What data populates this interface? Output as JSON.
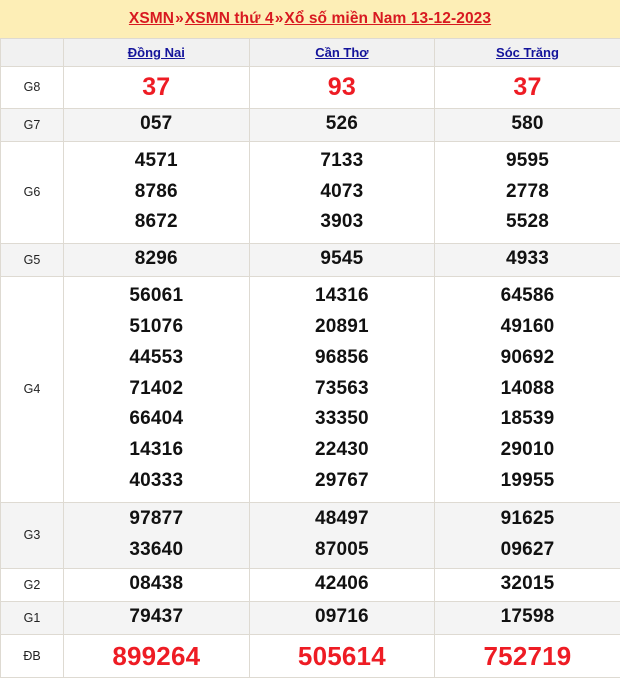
{
  "header": {
    "breadcrumb": [
      {
        "label": "XSMN",
        "type": "link"
      },
      {
        "label": "»",
        "type": "separator"
      },
      {
        "label": "XSMN thứ 4",
        "type": "link"
      },
      {
        "label": "»",
        "type": "separator"
      },
      {
        "label": "Xổ số miền Nam 13-12-2023",
        "type": "link"
      }
    ],
    "full_title": "XSMN » XSMN thứ 4 » Xổ số miền Nam 13-12-2023",
    "title_color": "#d81920",
    "band_color": "#fdeeb6"
  },
  "table": {
    "corner_label": "",
    "columns": [
      {
        "label": "Đồng Nai"
      },
      {
        "label": "Cần Thơ"
      },
      {
        "label": "Sóc Trăng"
      }
    ],
    "column_color": "#14149b",
    "highlight_color": "#ee1c24",
    "rows": [
      {
        "prize": "G8",
        "style": "highlight",
        "shaded": false,
        "values": [
          [
            "37"
          ],
          [
            "93"
          ],
          [
            "37"
          ]
        ]
      },
      {
        "prize": "G7",
        "style": "normal",
        "shaded": true,
        "values": [
          [
            "057"
          ],
          [
            "526"
          ],
          [
            "580"
          ]
        ]
      },
      {
        "prize": "G6",
        "style": "normal",
        "shaded": false,
        "values": [
          [
            "4571",
            "8786",
            "8672"
          ],
          [
            "7133",
            "4073",
            "3903"
          ],
          [
            "9595",
            "2778",
            "5528"
          ]
        ]
      },
      {
        "prize": "G5",
        "style": "normal",
        "shaded": true,
        "values": [
          [
            "8296"
          ],
          [
            "9545"
          ],
          [
            "4933"
          ]
        ]
      },
      {
        "prize": "G4",
        "style": "normal",
        "shaded": false,
        "values": [
          [
            "56061",
            "51076",
            "44553",
            "71402",
            "66404",
            "14316",
            "40333"
          ],
          [
            "14316",
            "20891",
            "96856",
            "73563",
            "33350",
            "22430",
            "29767"
          ],
          [
            "64586",
            "49160",
            "90692",
            "14088",
            "18539",
            "29010",
            "19955"
          ]
        ]
      },
      {
        "prize": "G3",
        "style": "normal",
        "shaded": true,
        "values": [
          [
            "97877",
            "33640"
          ],
          [
            "48497",
            "87005"
          ],
          [
            "91625",
            "09627"
          ]
        ]
      },
      {
        "prize": "G2",
        "style": "normal",
        "shaded": false,
        "values": [
          [
            "08438"
          ],
          [
            "42406"
          ],
          [
            "32015"
          ]
        ]
      },
      {
        "prize": "G1",
        "style": "normal",
        "shaded": true,
        "values": [
          [
            "79437"
          ],
          [
            "09716"
          ],
          [
            "17598"
          ]
        ]
      },
      {
        "prize": "ĐB",
        "style": "jackpot",
        "shaded": false,
        "values": [
          [
            "899264"
          ],
          [
            "505614"
          ],
          [
            "752719"
          ]
        ]
      }
    ]
  }
}
